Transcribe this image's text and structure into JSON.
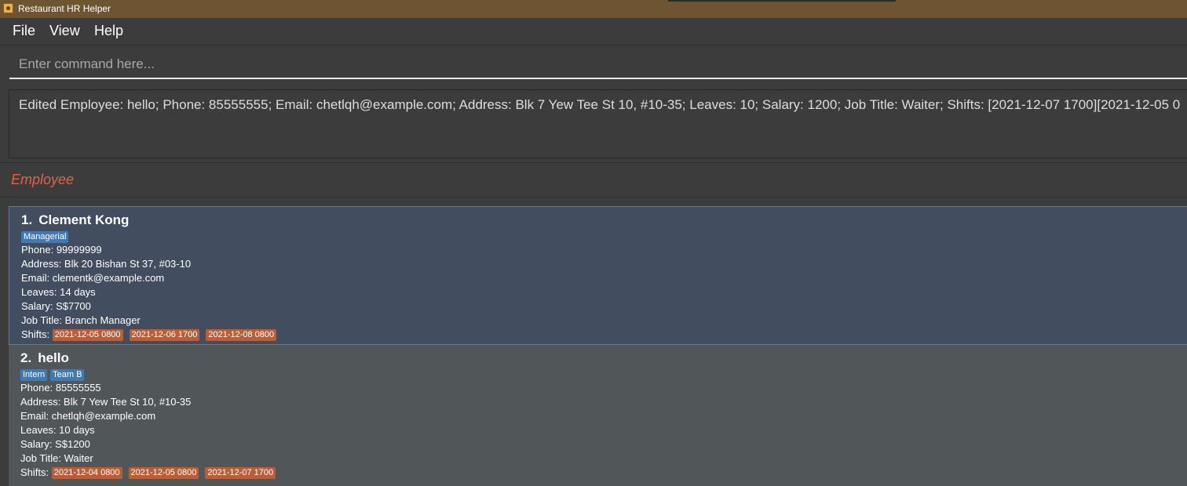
{
  "window": {
    "title": "Restaurant HR Helper"
  },
  "menu": [
    "File",
    "View",
    "Help"
  ],
  "command": {
    "placeholder": "Enter command here..."
  },
  "result": "Edited Employee: hello; Phone: 85555555; Email: chetlqh@example.com; Address: Blk 7 Yew Tee St 10, #10-35; Leaves: 10; Salary: 1200; Job Title: Waiter; Shifts: [2021-12-07 1700][2021-12-05 0",
  "list_header": "Employee",
  "employees": [
    {
      "index": "1.",
      "name": "Clement Kong",
      "tags": [
        "Managerial"
      ],
      "phone": "Phone: 99999999",
      "address": "Address: Blk 20 Bishan St 37, #03-10",
      "email": "Email: clementk@example.com",
      "leaves": "Leaves: 14 days",
      "salary": "Salary: S$7700",
      "job": "Job Title: Branch Manager",
      "shifts_label": "Shifts:",
      "shifts": [
        "2021-12-05 0800",
        "2021-12-06 1700",
        "2021-12-08 0800"
      ]
    },
    {
      "index": "2.",
      "name": "hello",
      "tags": [
        "Intern",
        "Team B"
      ],
      "phone": "Phone: 85555555",
      "address": "Address: Blk 7 Yew Tee St 10, #10-35",
      "email": "Email: chetlqh@example.com",
      "leaves": "Leaves: 10 days",
      "salary": "Salary: S$1200",
      "job": "Job Title: Waiter",
      "shifts_label": "Shifts:",
      "shifts": [
        "2021-12-04 0800",
        "2021-12-05 0800",
        "2021-12-07 1700"
      ]
    }
  ]
}
